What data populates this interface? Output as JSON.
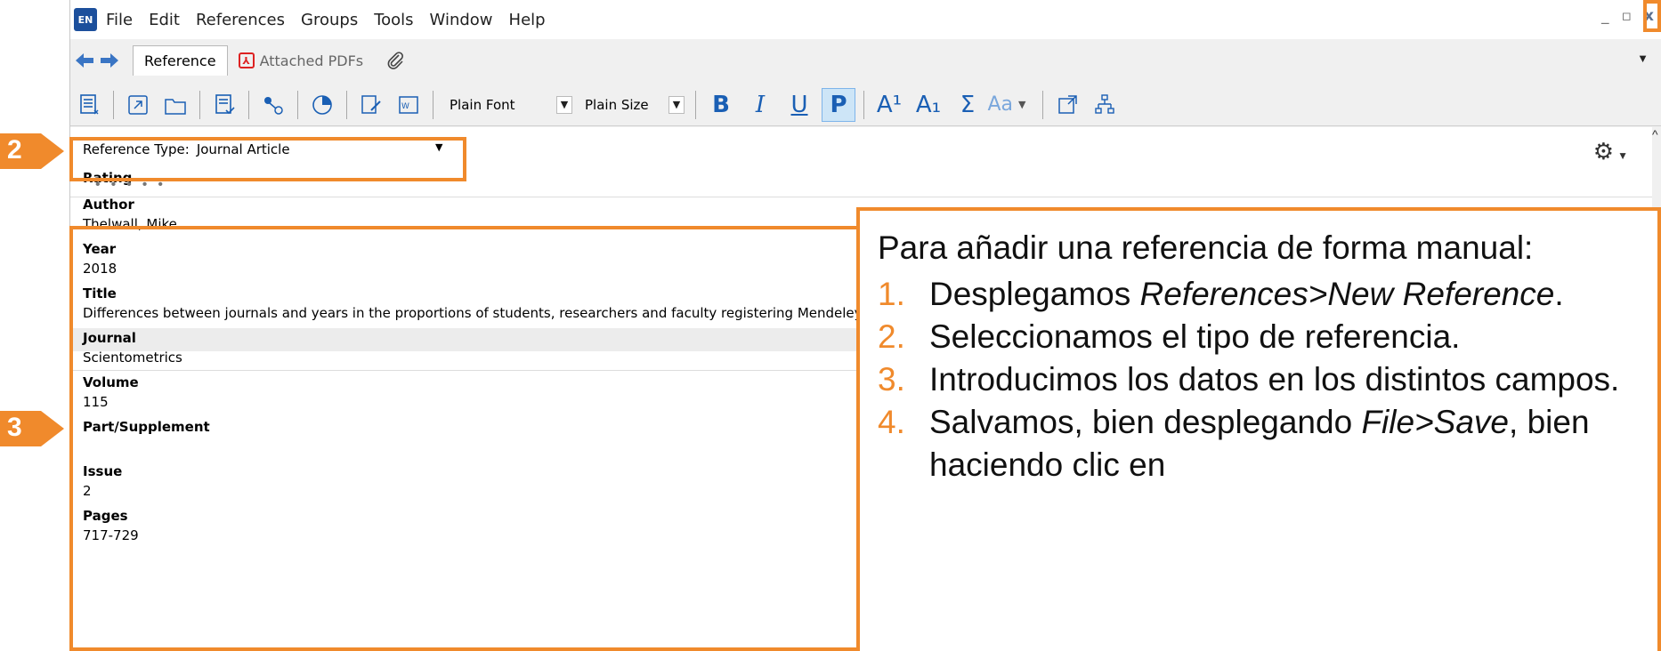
{
  "menubar": {
    "app_icon": "EN",
    "items": [
      "File",
      "Edit",
      "References",
      "Groups",
      "Tools",
      "Window",
      "Help"
    ],
    "window_controls": [
      "_",
      "▫",
      "x"
    ]
  },
  "tabs": {
    "active": "Reference",
    "inactive": "Attached PDFs",
    "icons": [
      "back-arrow-icon",
      "forward-arrow-icon",
      "pdf-icon",
      "paperclip-icon"
    ]
  },
  "toolbar": {
    "font": "Plain Font",
    "size": "Plain Size",
    "bold": "B",
    "italic": "I",
    "underline": "U",
    "plain": "P",
    "superscript": "A¹",
    "subscript": "A₁",
    "symbol": "Σ",
    "font_style": "Aa"
  },
  "reference": {
    "type_label": "Reference Type:",
    "type_value": "Journal Article",
    "rating_label": "Rating",
    "fields": [
      {
        "label": "Author",
        "value": "Thelwall, Mike"
      },
      {
        "label": "Year",
        "value": "2018"
      },
      {
        "label": "Title",
        "value": "Differences between journals and years in the proportions of students, researchers and faculty registering Mendeley articles"
      },
      {
        "label": "Journal",
        "value": "Scientometrics"
      },
      {
        "label": "Volume",
        "value": "115"
      },
      {
        "label": "Part/Supplement",
        "value": ""
      },
      {
        "label": "Issue",
        "value": "2"
      },
      {
        "label": "Pages",
        "value": "717-729"
      }
    ]
  },
  "annotations": {
    "step2": "2",
    "step3": "3",
    "accent": "#f08a2c"
  },
  "callout": {
    "intro": "Para añadir una referencia de forma manual:",
    "steps": [
      {
        "num": "1.",
        "before": "Desplegamos ",
        "emph": "References>New Reference",
        "after": "."
      },
      {
        "num": "2.",
        "before": "Seleccionamos el tipo de referencia.",
        "emph": "",
        "after": ""
      },
      {
        "num": "3.",
        "before": "Introducimos los datos en los distintos campos.",
        "emph": "",
        "after": ""
      },
      {
        "num": "4.",
        "before": "Salvamos, bien desplegando ",
        "emph": "File>Save",
        "after": ", bien haciendo clic en"
      }
    ]
  }
}
